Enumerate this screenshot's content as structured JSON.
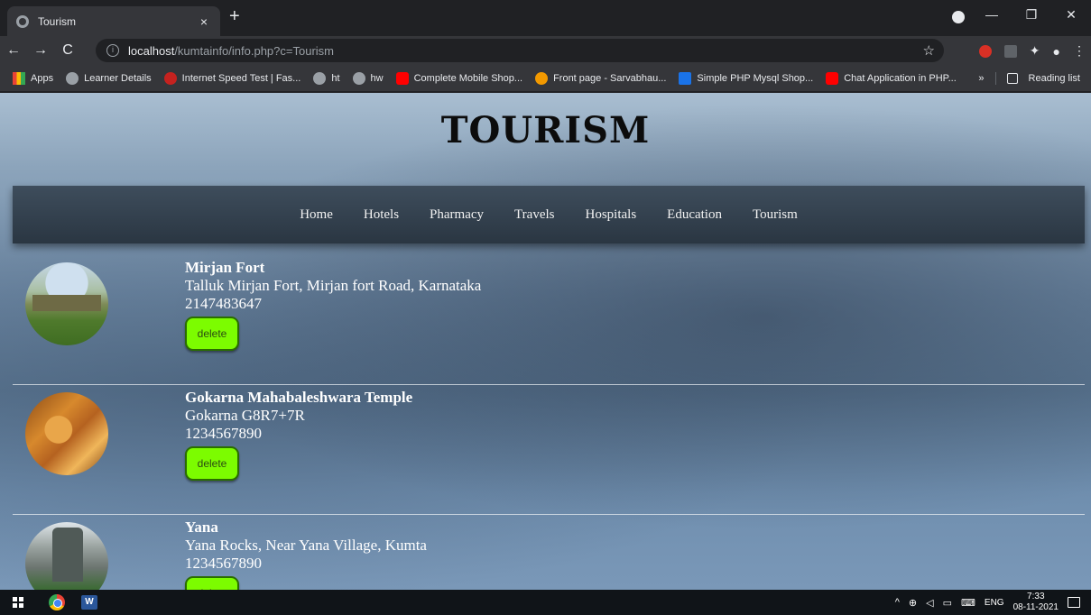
{
  "browser": {
    "tab_title": "Tourism",
    "tab_close": "×",
    "new_tab": "+",
    "window_controls": {
      "minimize": "—",
      "maximize": "❐",
      "close": "✕"
    },
    "nav": {
      "back": "←",
      "forward": "→",
      "reload": "C"
    },
    "address": {
      "host": "localhost",
      "path": "/kumtainfo/info.php?c=Tourism",
      "info": "i",
      "star": "☆"
    },
    "extensions": {
      "puzzle": "✦",
      "profile": "●",
      "menu": "⋮"
    },
    "bookmarks": [
      {
        "label": "Apps",
        "icon": "apps-icon"
      },
      {
        "label": "Learner Details",
        "icon": "globe-icon"
      },
      {
        "label": "Internet Speed Test | Fas...",
        "icon": "gauge-icon"
      },
      {
        "label": "ht",
        "icon": "globe-icon"
      },
      {
        "label": "hw",
        "icon": "globe-icon"
      },
      {
        "label": "Complete Mobile Shop...",
        "icon": "youtube-icon"
      },
      {
        "label": "Front page - Sarvabhau...",
        "icon": "target-icon"
      },
      {
        "label": "Simple PHP Mysql Shop...",
        "icon": "w-icon"
      },
      {
        "label": "Chat Application in PHP...",
        "icon": "youtube-icon"
      }
    ],
    "more_bookmarks": "»",
    "reading_list": "Reading list"
  },
  "site": {
    "title": "TOURISM",
    "nav": [
      "Home",
      "Hotels",
      "Pharmacy",
      "Travels",
      "Hospitals",
      "Education",
      "Tourism"
    ],
    "places": [
      {
        "name": "Mirjan Fort",
        "address": "Talluk Mirjan Fort, Mirjan fort Road, Karnataka",
        "phone": "2147483647",
        "action": "delete"
      },
      {
        "name": "Gokarna Mahabaleshwara Temple",
        "address": "Gokarna G8R7+7R",
        "phone": "1234567890",
        "action": "delete"
      },
      {
        "name": "Yana",
        "address": "Yana Rocks, Near Yana Village, Kumta",
        "phone": "1234567890",
        "action": "delete"
      }
    ]
  },
  "taskbar": {
    "tray_caret": "^",
    "language": "ENG",
    "time": "7:33",
    "date": "08-11-2021"
  },
  "colors": {
    "delete_button": "#7cfc00",
    "navbar": "#2f3b47",
    "title": "#0c0c0c"
  }
}
